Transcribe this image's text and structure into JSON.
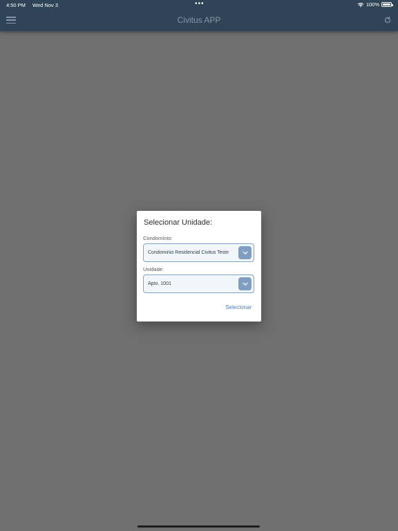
{
  "status_bar": {
    "time": "4:50 PM",
    "date": "Wed Nov 3",
    "dots": "•••",
    "battery_text": "100%",
    "icons": [
      "wifi-icon",
      "battery-icon"
    ]
  },
  "app_bar": {
    "title": "Civitus APP",
    "menu_icon": "hamburger-menu-icon",
    "refresh_icon": "refresh-icon"
  },
  "dialog": {
    "title": "Selecionar Unidade:",
    "condominio": {
      "label": "Condomínio:",
      "selected": "Condominio Residencial Civitus Teste"
    },
    "unidade": {
      "label": "Unidade:",
      "selected": "Apto. 1001"
    },
    "action_label": "Selecionar"
  },
  "colors": {
    "app_bar": "#2f4456",
    "backdrop": "#6f6f6f",
    "accent": "#4d7bb0",
    "select_border": "#7fa3c7"
  }
}
